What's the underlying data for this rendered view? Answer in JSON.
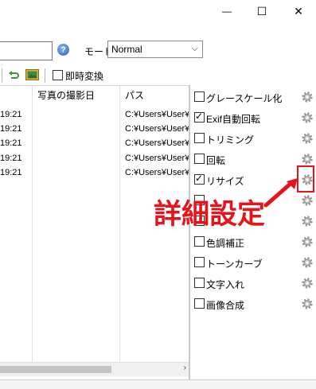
{
  "window": {
    "minimize_glyph": "—",
    "maximize_glyph": "☐",
    "close_glyph": "✕"
  },
  "toolbar": {
    "help_glyph": "?",
    "mode_label": "モード",
    "mode_value": "Normal",
    "instant_convert_label": "即時変換",
    "instant_convert_checked": false
  },
  "table": {
    "headers": [
      "写真の撮影日",
      "パス"
    ],
    "rows": [
      {
        "time": "19:21",
        "path": "C:¥Users¥User¥"
      },
      {
        "time": "19:21",
        "path": "C:¥Users¥User¥"
      },
      {
        "time": "19:21",
        "path": "C:¥Users¥User¥"
      },
      {
        "time": "19:21",
        "path": "C:¥Users¥User¥"
      },
      {
        "time": "19:21",
        "path": "C:¥Users¥User¥"
      }
    ]
  },
  "options": [
    {
      "label": "グレースケール化",
      "checked": false
    },
    {
      "label": "Exif自動回転",
      "checked": true
    },
    {
      "label": "トリミング",
      "checked": false
    },
    {
      "label": "回転",
      "checked": false
    },
    {
      "label": "リサイズ",
      "checked": true
    },
    {
      "label": "",
      "checked": false
    },
    {
      "label": "",
      "checked": false
    },
    {
      "label": "色調補正",
      "checked": false
    },
    {
      "label": "トーンカーブ",
      "checked": false
    },
    {
      "label": "文字入れ",
      "checked": false
    },
    {
      "label": "画像合成",
      "checked": false
    }
  ],
  "annotation": {
    "text": "詳細設定",
    "color": "#e8121b"
  },
  "colors": {
    "accent_red": "#e8121b",
    "help_blue": "#2a63c6"
  }
}
